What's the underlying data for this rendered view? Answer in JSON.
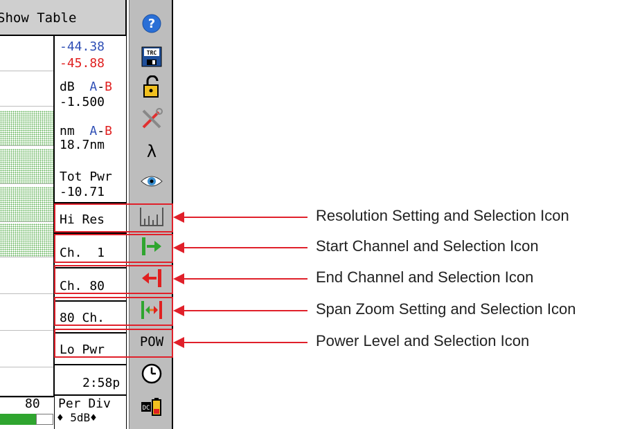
{
  "header": {
    "show_table_label": "Show Table"
  },
  "readouts": {
    "val_blue": "-44.38",
    "val_red": "-45.88",
    "db_label": "dB",
    "a_label": "A",
    "dash": "-",
    "b_label": "B",
    "db_value": "-1.500",
    "nm_label": "nm",
    "nm_value": "18.7nm",
    "tot_pwr_label": "Tot Pwr",
    "tot_pwr_value": "-10.71",
    "resolution": "Hi Res",
    "start_channel": "Ch.  1",
    "end_channel": "Ch. 80",
    "span_zoom": "80 Ch.",
    "power_level": "Lo Pwr",
    "time": "2:58p",
    "per_div_label": "Per Div",
    "per_div_value": "♦ 5dB♦",
    "left_count": "80"
  },
  "icons": {
    "help": "help-icon",
    "trc": "trc-save-icon",
    "trc_text": "TRC",
    "lock": "lock-icon",
    "tools": "tools-icon",
    "lambda": "lambda-icon",
    "eye": "eye-icon",
    "resolution": "resolution-icon",
    "start": "start-channel-icon",
    "end": "end-channel-icon",
    "span": "span-zoom-icon",
    "pow": "power-icon",
    "pow_text": "POW",
    "clock": "clock-icon",
    "battery": "battery-icon"
  },
  "callouts": {
    "resolution": "Resolution Setting and Selection Icon",
    "start": "Start Channel and  Selection Icon",
    "end": "End Channel and Selection Icon",
    "span": "Span Zoom Setting and Selection Icon",
    "power": "Power Level and Selection Icon"
  },
  "colors": {
    "highlight": "#e0202a",
    "blue": "#2f4fb5",
    "red": "#e02020",
    "green_bar": "#2fa52f"
  }
}
